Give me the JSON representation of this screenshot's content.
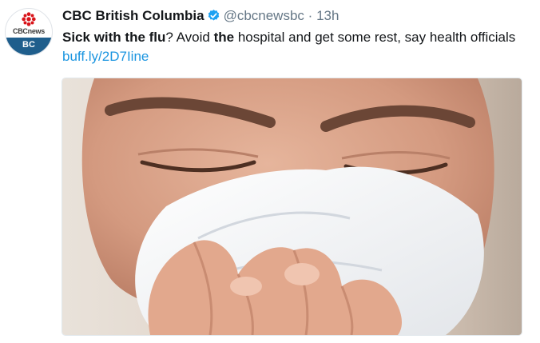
{
  "tweet": {
    "avatar": {
      "brand": "CBCnews",
      "region": "BC",
      "icon": "cbc-gem-logo",
      "region_color": "#1f5e8c"
    },
    "author_name": "CBC British Columbia",
    "verified_icon": "verified-badge-icon",
    "handle": "@cbcnewsbc",
    "separator": "·",
    "time": "13h",
    "text_parts": [
      "Sick with the flu",
      "? Avoid ",
      "the",
      " hospital and get some rest, say health officials"
    ],
    "link": "buff.ly/2D7Iine",
    "media": {
      "type": "photo",
      "icon": "man-blowing-nose-photo"
    }
  },
  "colors": {
    "link": "#1b95e0",
    "meta": "#657786",
    "verified": "#1da1f2"
  }
}
